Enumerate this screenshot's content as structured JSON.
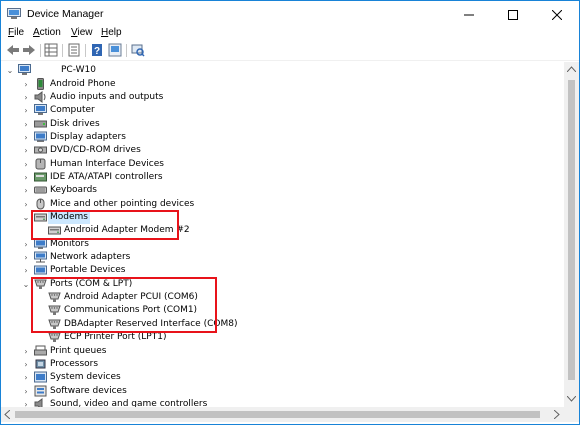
{
  "window": {
    "title": "Device Manager",
    "menu": [
      {
        "key": "F",
        "rest": "ile"
      },
      {
        "key": "A",
        "rest": "ction"
      },
      {
        "key": "V",
        "rest": "iew"
      },
      {
        "key": "H",
        "rest": "elp"
      }
    ]
  },
  "tree": {
    "root": "PC-W10",
    "nodes": [
      {
        "label": "Android Phone",
        "expander": "collapsed",
        "icon": "phone-icon",
        "level": 1
      },
      {
        "label": "Audio inputs and outputs",
        "expander": "collapsed",
        "icon": "speaker-icon",
        "level": 1
      },
      {
        "label": "Computer",
        "expander": "collapsed",
        "icon": "computer-icon",
        "level": 1
      },
      {
        "label": "Disk drives",
        "expander": "collapsed",
        "icon": "disk-icon",
        "level": 1
      },
      {
        "label": "Display adapters",
        "expander": "collapsed",
        "icon": "display-icon",
        "level": 1
      },
      {
        "label": "DVD/CD-ROM drives",
        "expander": "collapsed",
        "icon": "dvd-icon",
        "level": 1
      },
      {
        "label": "Human Interface Devices",
        "expander": "collapsed",
        "icon": "hid-icon",
        "level": 1
      },
      {
        "label": "IDE ATA/ATAPI controllers",
        "expander": "collapsed",
        "icon": "ide-icon",
        "level": 1
      },
      {
        "label": "Keyboards",
        "expander": "collapsed",
        "icon": "keyboard-icon",
        "level": 1
      },
      {
        "label": "Mice and other pointing devices",
        "expander": "collapsed",
        "icon": "mouse-icon",
        "level": 1
      },
      {
        "label": "Modems",
        "expander": "expanded",
        "icon": "modem-icon",
        "level": 1,
        "selected": true
      },
      {
        "label": "Android Adapter Modem #2",
        "expander": "none",
        "icon": "modem-icon",
        "level": 2
      },
      {
        "label": "Monitors",
        "expander": "collapsed",
        "icon": "monitor-icon",
        "level": 1
      },
      {
        "label": "Network adapters",
        "expander": "collapsed",
        "icon": "network-icon",
        "level": 1
      },
      {
        "label": "Portable Devices",
        "expander": "collapsed",
        "icon": "portable-icon",
        "level": 1
      },
      {
        "label": "Ports (COM & LPT)",
        "expander": "expanded",
        "icon": "port-icon",
        "level": 1
      },
      {
        "label": "Android Adapter PCUI (COM6)",
        "expander": "none",
        "icon": "port-icon",
        "level": 2
      },
      {
        "label": "Communications Port (COM1)",
        "expander": "none",
        "icon": "port-icon",
        "level": 2
      },
      {
        "label": "DBAdapter Reserved Interface (COM8)",
        "expander": "none",
        "icon": "port-icon",
        "level": 2
      },
      {
        "label": "ECP Printer Port (LPT1)",
        "expander": "none",
        "icon": "port-icon",
        "level": 2
      },
      {
        "label": "Print queues",
        "expander": "collapsed",
        "icon": "printer-icon",
        "level": 1
      },
      {
        "label": "Processors",
        "expander": "collapsed",
        "icon": "processor-icon",
        "level": 1
      },
      {
        "label": "System devices",
        "expander": "collapsed",
        "icon": "system-icon",
        "level": 1
      },
      {
        "label": "Software devices",
        "expander": "collapsed",
        "icon": "software-icon",
        "level": 1
      },
      {
        "label": "Sound, video and game controllers",
        "expander": "collapsed",
        "icon": "sound-icon",
        "level": 1
      }
    ]
  },
  "colors": {
    "highlight_box": "#e8131a",
    "selection": "#cce8ff",
    "window_border": "#1883d7"
  }
}
